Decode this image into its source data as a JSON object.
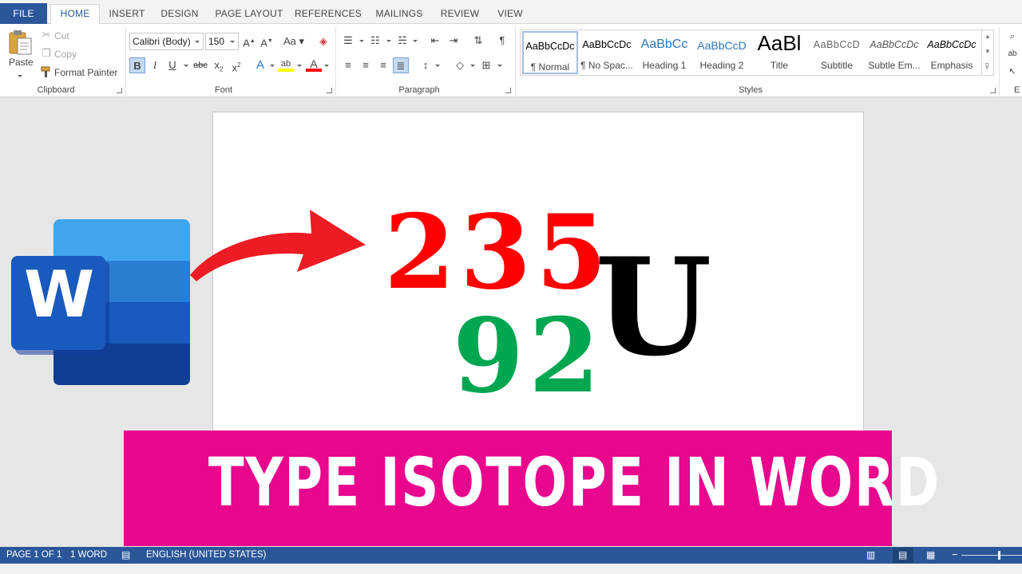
{
  "tabs": [
    "FILE",
    "HOME",
    "INSERT",
    "DESIGN",
    "PAGE LAYOUT",
    "REFERENCES",
    "MAILINGS",
    "REVIEW",
    "VIEW"
  ],
  "clipboard": {
    "paste": "Paste",
    "cut": "Cut",
    "copy": "Copy",
    "format_painter": "Format Painter",
    "label": "Clipboard"
  },
  "font": {
    "name": "Calibri (Body)",
    "size": "150",
    "label": "Font"
  },
  "paragraph": {
    "label": "Paragraph"
  },
  "styles": {
    "label": "Styles",
    "items": [
      {
        "sample": "AaBbCcDc",
        "name": "¶ Normal"
      },
      {
        "sample": "AaBbCcDc",
        "name": "¶ No Spac..."
      },
      {
        "sample": "AaBbCc",
        "name": "Heading 1"
      },
      {
        "sample": "AaBbCcD",
        "name": "Heading 2"
      },
      {
        "sample": "AaBl",
        "name": "Title"
      },
      {
        "sample": "AaBbCcD",
        "name": "Subtitle"
      },
      {
        "sample": "AaBbCcDc",
        "name": "Subtle Em..."
      },
      {
        "sample": "AaBbCcDc",
        "name": "Emphasis"
      }
    ]
  },
  "editing_label": "E",
  "document": {
    "mass_number": "235",
    "atomic_number": "92",
    "symbol": "U"
  },
  "colors": {
    "brand": "#2b579a",
    "mass_number": "#ff0000",
    "atomic_number": "#00a650",
    "banner": "#e8078d",
    "arrow": "#ed1c24"
  },
  "banner": {
    "text": "TYPE ISOTOPE IN WORD"
  },
  "status": {
    "page": "PAGE 1 OF 1",
    "words": "1 WORD",
    "language": "ENGLISH (UNITED STATES)"
  },
  "icons": {
    "word_logo_letter": "W"
  }
}
